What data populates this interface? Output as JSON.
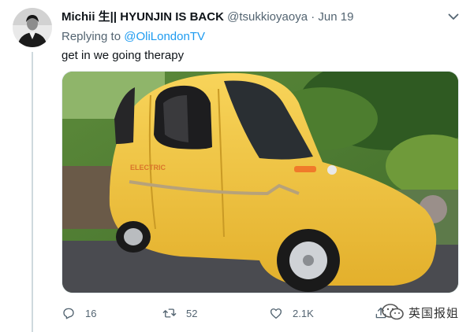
{
  "tweet": {
    "display_name": "Michii 生|| HYUNJIN IS BACK",
    "handle": "@tsukkioyaoya",
    "separator": "·",
    "timestamp": "Jun 19",
    "replying_prefix": "Replying to",
    "replying_to": "@OliLondonTV",
    "text": "get in we going therapy",
    "car_decal": "ELECTRIC"
  },
  "actions": {
    "reply_count": "16",
    "retweet_count": "52",
    "like_count": "2.1K"
  },
  "watermark": {
    "text": "英国报姐"
  },
  "colors": {
    "link": "#1d9bf0",
    "muted": "#536471",
    "car_body": "#f3c63c"
  }
}
